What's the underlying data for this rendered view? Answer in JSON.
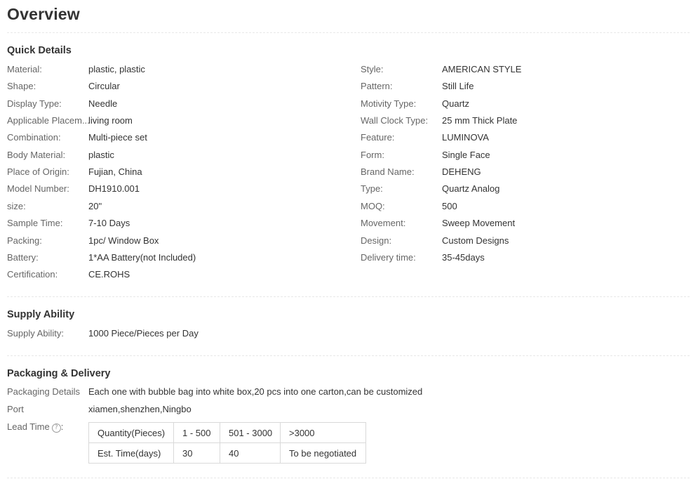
{
  "page_title": "Overview",
  "quick_details": {
    "title": "Quick Details",
    "left": [
      {
        "label": "Material:",
        "value": "plastic, plastic"
      },
      {
        "label": "Shape:",
        "value": "Circular"
      },
      {
        "label": "Display Type:",
        "value": "Needle"
      },
      {
        "label": "Applicable Placem...",
        "value": "living room"
      },
      {
        "label": "Combination:",
        "value": "Multi-piece set"
      },
      {
        "label": "Body Material:",
        "value": "plastic"
      },
      {
        "label": "Place of Origin:",
        "value": "Fujian, China"
      },
      {
        "label": "Model Number:",
        "value": "DH1910.001"
      },
      {
        "label": "size:",
        "value": "20\""
      },
      {
        "label": "Sample Time:",
        "value": "7-10 Days"
      },
      {
        "label": "Packing:",
        "value": "1pc/ Window Box"
      },
      {
        "label": "Battery:",
        "value": "1*AA Battery(not Included)"
      },
      {
        "label": "Certification:",
        "value": "CE.ROHS"
      }
    ],
    "right": [
      {
        "label": "Style:",
        "value": "AMERICAN STYLE"
      },
      {
        "label": "Pattern:",
        "value": "Still Life"
      },
      {
        "label": "Motivity Type:",
        "value": "Quartz"
      },
      {
        "label": "Wall Clock Type:",
        "value": "25 mm Thick Plate"
      },
      {
        "label": "Feature:",
        "value": "LUMINOVA"
      },
      {
        "label": "Form:",
        "value": "Single Face"
      },
      {
        "label": "Brand Name:",
        "value": "DEHENG"
      },
      {
        "label": "Type:",
        "value": "Quartz Analog"
      },
      {
        "label": "MOQ:",
        "value": "500"
      },
      {
        "label": "Movement:",
        "value": "Sweep Movement"
      },
      {
        "label": "Design:",
        "value": "Custom Designs"
      },
      {
        "label": "Delivery time:",
        "value": "35-45days"
      }
    ]
  },
  "supply_ability": {
    "title": "Supply Ability",
    "label": "Supply Ability:",
    "value": "1000 Piece/Pieces per Day"
  },
  "packaging_delivery": {
    "title": "Packaging & Delivery",
    "details_label": "Packaging Details",
    "details_value": "Each one with bubble bag into white box,20 pcs into one carton,can be customized",
    "port_label": "Port",
    "port_value": "xiamen,shenzhen,Ningbo",
    "lead_time_label": "Lead Time",
    "help_icon": "question-circle-icon",
    "help_glyph": "?",
    "lead_table": {
      "row1": [
        "Quantity(Pieces)",
        "1 - 500",
        "501 - 3000",
        ">3000"
      ],
      "row2": [
        "Est. Time(days)",
        "30",
        "40",
        "To be negotiated"
      ]
    }
  }
}
